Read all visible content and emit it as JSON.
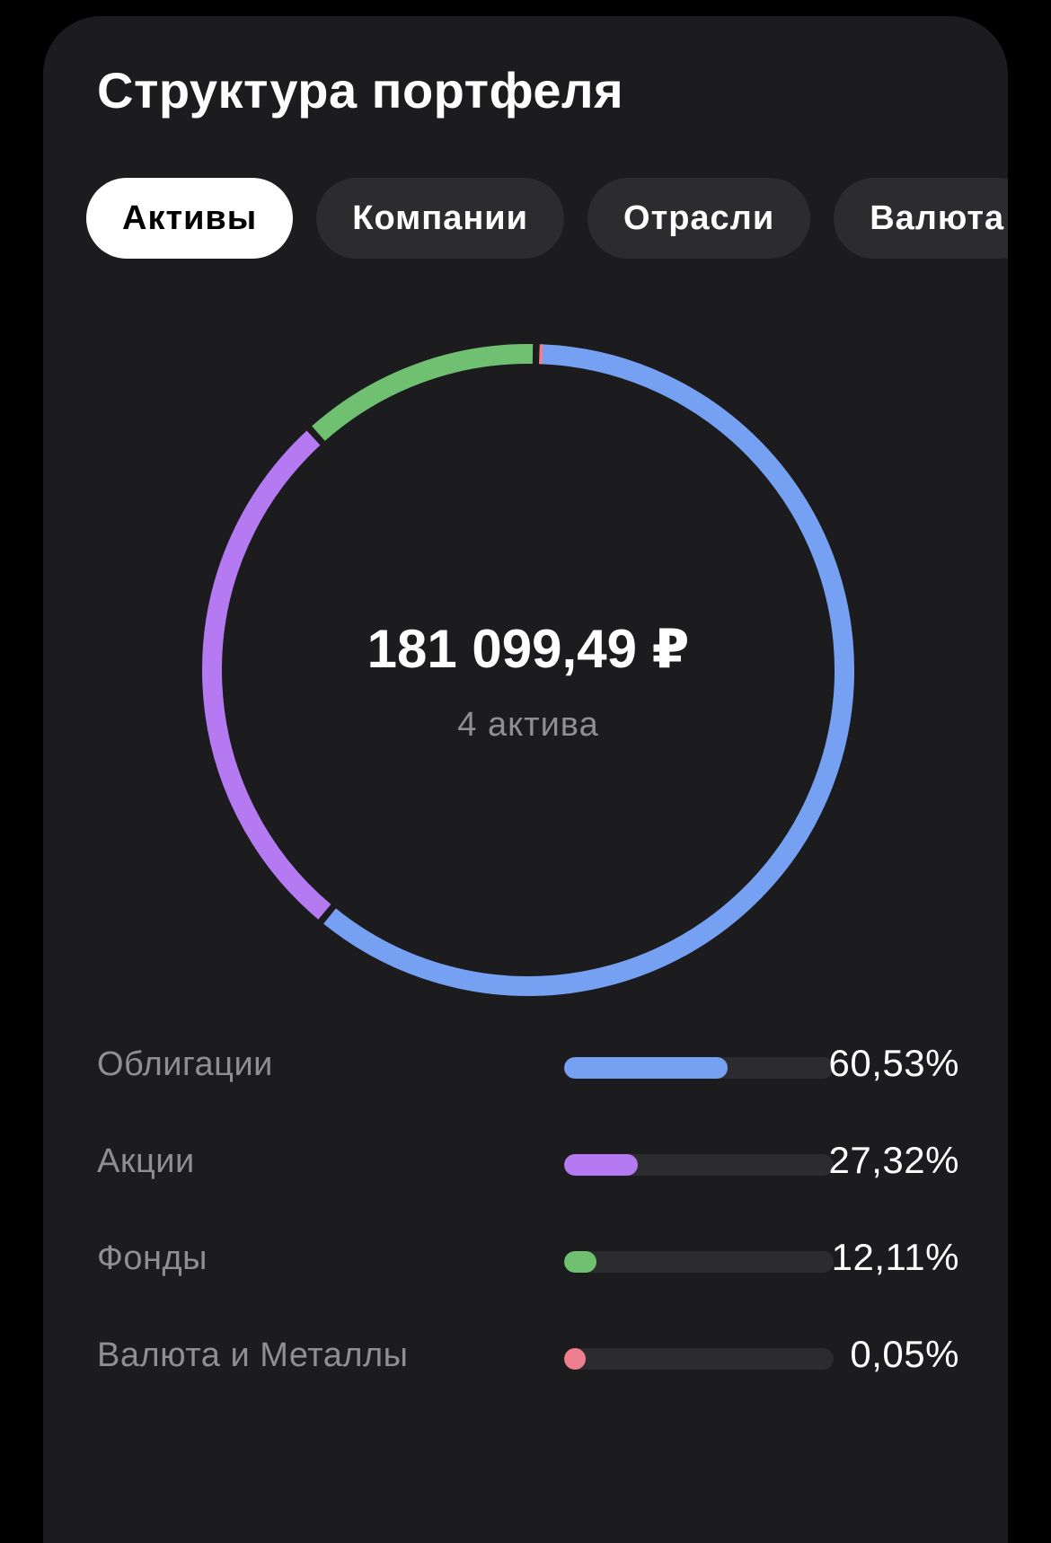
{
  "card": {
    "title": "Структура портфеля"
  },
  "tabs": [
    {
      "label": "Активы",
      "active": true
    },
    {
      "label": "Компании",
      "active": false
    },
    {
      "label": "Отрасли",
      "active": false
    },
    {
      "label": "Валюта",
      "active": false
    }
  ],
  "summary": {
    "total": "181 099,49 ₽",
    "count_label": "4 актива"
  },
  "chart_data": {
    "type": "pie",
    "variant": "donut",
    "categories": [
      "Облигации",
      "Акции",
      "Фонды",
      "Валюта и Металлы"
    ],
    "values": [
      60.53,
      27.32,
      12.11,
      0.05
    ],
    "colors": [
      "#76a0f2",
      "#b57af2",
      "#70c072",
      "#ef7f8f"
    ]
  },
  "legend": [
    {
      "label": "Облигации",
      "percent": "60,53%",
      "color": "#76a0f2"
    },
    {
      "label": "Акции",
      "percent": "27,32%",
      "color": "#b57af2"
    },
    {
      "label": "Фонды",
      "percent": "12,11%",
      "color": "#70c072"
    },
    {
      "label": "Валюта и Металлы",
      "percent": "0,05%",
      "color": "#ef7f8f"
    }
  ]
}
